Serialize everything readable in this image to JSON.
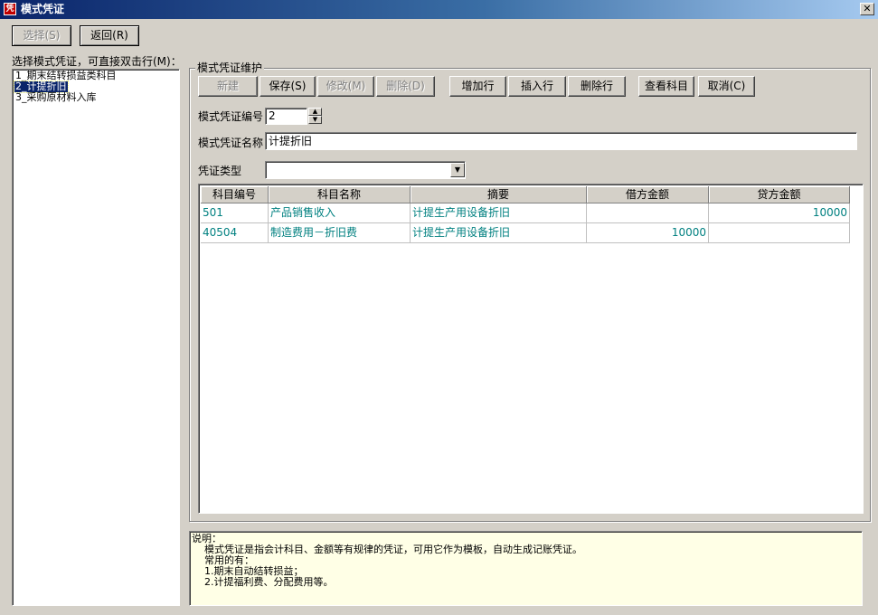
{
  "window": {
    "title": "模式凭证",
    "app_icon": "voucher-app-icon",
    "close_glyph": "✕"
  },
  "toolbar": {
    "select_label": "选择(S)",
    "back_label": "返回(R)"
  },
  "left": {
    "prompt": "选择模式凭证，可直接双击行(M)：",
    "items": [
      "1_期末结转损益类科目",
      "2_计提折旧",
      "3_采购原材料入库"
    ],
    "selected_index": 1
  },
  "maint": {
    "group_title": "模式凭证维护",
    "buttons": {
      "new": "新建",
      "save": "保存(S)",
      "edit": "修改(M)",
      "delete": "删除(D)",
      "add_row": "增加行",
      "insert_row": "插入行",
      "delete_row": "删除行",
      "view_subject": "查看科目",
      "cancel": "取消(C)"
    },
    "code_label": "模式凭证编号",
    "code_value": "2",
    "name_label": "模式凭证名称",
    "name_value": "计提折旧",
    "type_label": "凭证类型",
    "type_value": ""
  },
  "grid": {
    "columns": [
      "科目编号",
      "科目名称",
      "摘要",
      "借方金额",
      "贷方金额"
    ],
    "rows": [
      [
        "501",
        "产品销售收入",
        "计提生产用设备折旧",
        "",
        "10000"
      ],
      [
        "40504",
        "制造费用－折旧费",
        "计提生产用设备折旧",
        "10000",
        ""
      ]
    ]
  },
  "notes": {
    "lines": [
      "说明：",
      "    模式凭证是指会计科目、金额等有规律的凭证，可用它作为模板，自动生成记账凭证。",
      "    常用的有：",
      "    1.期末自动结转损益；",
      "    2.计提福利费、分配费用等。"
    ]
  },
  "colors": {
    "title_start": "#0a246a",
    "title_end": "#a6caf0",
    "grid_text": "#008080",
    "selection": "#0a246a",
    "notes_bg": "#ffffe6"
  }
}
